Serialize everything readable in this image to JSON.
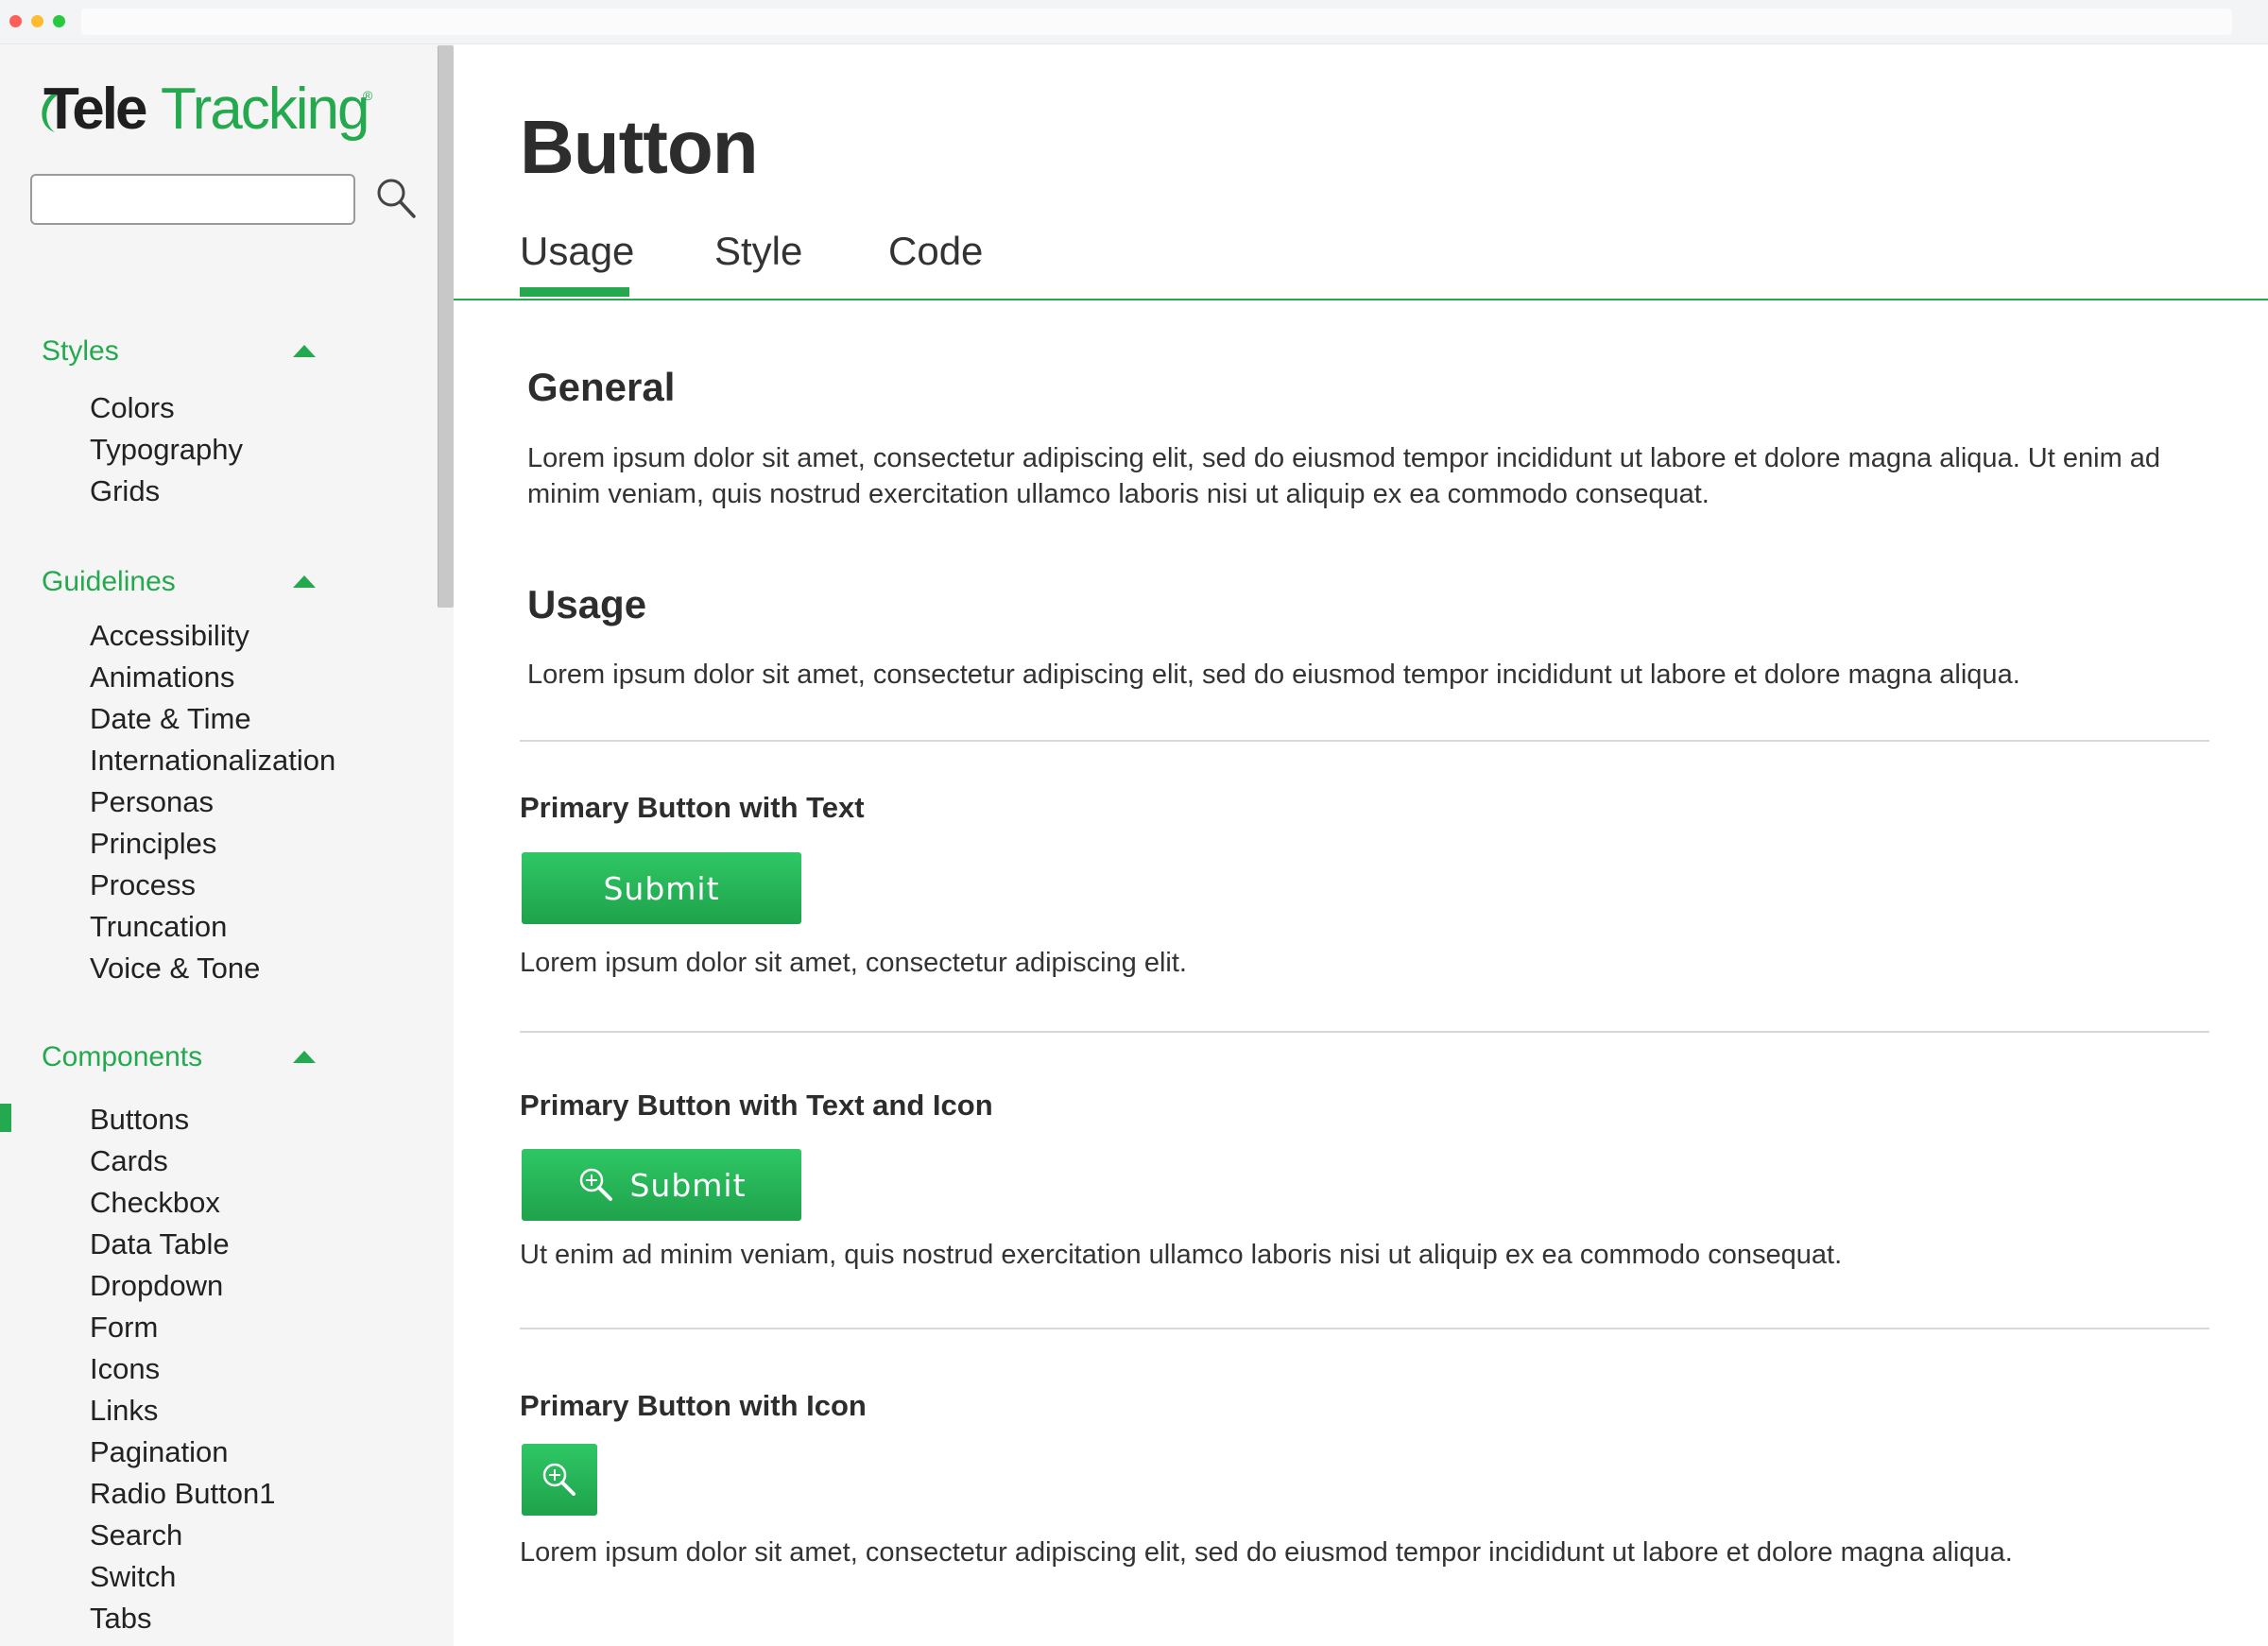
{
  "sidebar": {
    "logo": {
      "part1": "Tele",
      "part2": "Tracking",
      "mark": "®"
    },
    "search": {
      "value": "",
      "placeholder": ""
    },
    "sections": [
      {
        "title": "Styles",
        "items": [
          "Colors",
          "Typography",
          "Grids"
        ]
      },
      {
        "title": "Guidelines",
        "items": [
          "Accessibility",
          "Animations",
          "Date & Time",
          "Internationalization",
          "Personas",
          "Principles",
          "Process",
          "Truncation",
          "Voice & Tone"
        ]
      },
      {
        "title": "Components",
        "items": [
          "Buttons",
          "Cards",
          "Checkbox",
          "Data Table",
          "Dropdown",
          "Form",
          "Icons",
          "Links",
          "Pagination",
          "Radio Button1",
          "Search",
          "Switch",
          "Tabs"
        ]
      }
    ],
    "active_item": "Buttons"
  },
  "main": {
    "title": "Button",
    "tabs": [
      {
        "label": "Usage",
        "active": true
      },
      {
        "label": "Style",
        "active": false
      },
      {
        "label": "Code",
        "active": false
      }
    ],
    "general": {
      "heading": "General",
      "text": "Lorem ipsum dolor sit amet, consectetur adipiscing elit, sed do eiusmod tempor incididunt ut labore et dolore magna aliqua. Ut enim ad minim veniam, quis nostrud exercitation ullamco laboris nisi ut aliquip ex ea commodo consequat."
    },
    "usage": {
      "heading": "Usage",
      "text": "Lorem ipsum dolor sit amet, consectetur adipiscing elit, sed do eiusmod tempor incididunt ut labore et dolore magna aliqua."
    },
    "examples": [
      {
        "title": "Primary Button with Text",
        "button_label": "Submit",
        "description": "Lorem ipsum dolor sit amet, consectetur adipiscing elit."
      },
      {
        "title": "Primary Button with Text and Icon",
        "button_label": "Submit",
        "description": "Ut enim ad minim veniam, quis nostrud exercitation ullamco laboris nisi ut aliquip ex ea commodo consequat."
      },
      {
        "title": "Primary Button with Icon",
        "description": "Lorem ipsum dolor sit amet, consectetur adipiscing elit, sed do eiusmod tempor incididunt ut labore et dolore magna aliqua."
      }
    ]
  },
  "icons": {
    "search": "magnifier-icon",
    "collapse": "triangle-up-icon",
    "button": "magnifier-plus-icon"
  },
  "colors": {
    "brand_green": "#25a94f",
    "logo_dark": "#1f1f1f",
    "text": "#333333"
  }
}
